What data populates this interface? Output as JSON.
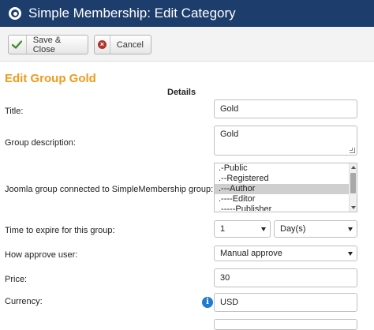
{
  "header": {
    "title": "Simple Membership: Edit Category",
    "icon": "category-icon"
  },
  "toolbar": {
    "save_close_label": "Save & Close",
    "cancel_label": "Cancel"
  },
  "page": {
    "title": "Edit Group Gold",
    "section": "Details"
  },
  "form": {
    "title": {
      "label": "Title:",
      "value": "Gold"
    },
    "description": {
      "label": "Group description:",
      "value": "Gold"
    },
    "joomla_group": {
      "label": "Joomla group connected to SimpleMembership group:",
      "options": [
        ".-Public",
        ".--Registered",
        ".---Author",
        ".----Editor",
        ".-----Publisher"
      ],
      "selected": ".---Author"
    },
    "expire": {
      "label": "Time to expire for this group:",
      "amount": "1",
      "unit": "Day(s)"
    },
    "approve": {
      "label": "How approve user:",
      "value": "Manual approve"
    },
    "price": {
      "label": "Price:",
      "value": "30"
    },
    "currency": {
      "label": "Currency:",
      "value": "USD"
    }
  },
  "colors": {
    "header_bg": "#1d3d6c",
    "title_orange": "#f09a1a",
    "save_check": "#3b8a2a",
    "cancel_red": "#b0322b",
    "info_blue": "#1f7ad1"
  }
}
